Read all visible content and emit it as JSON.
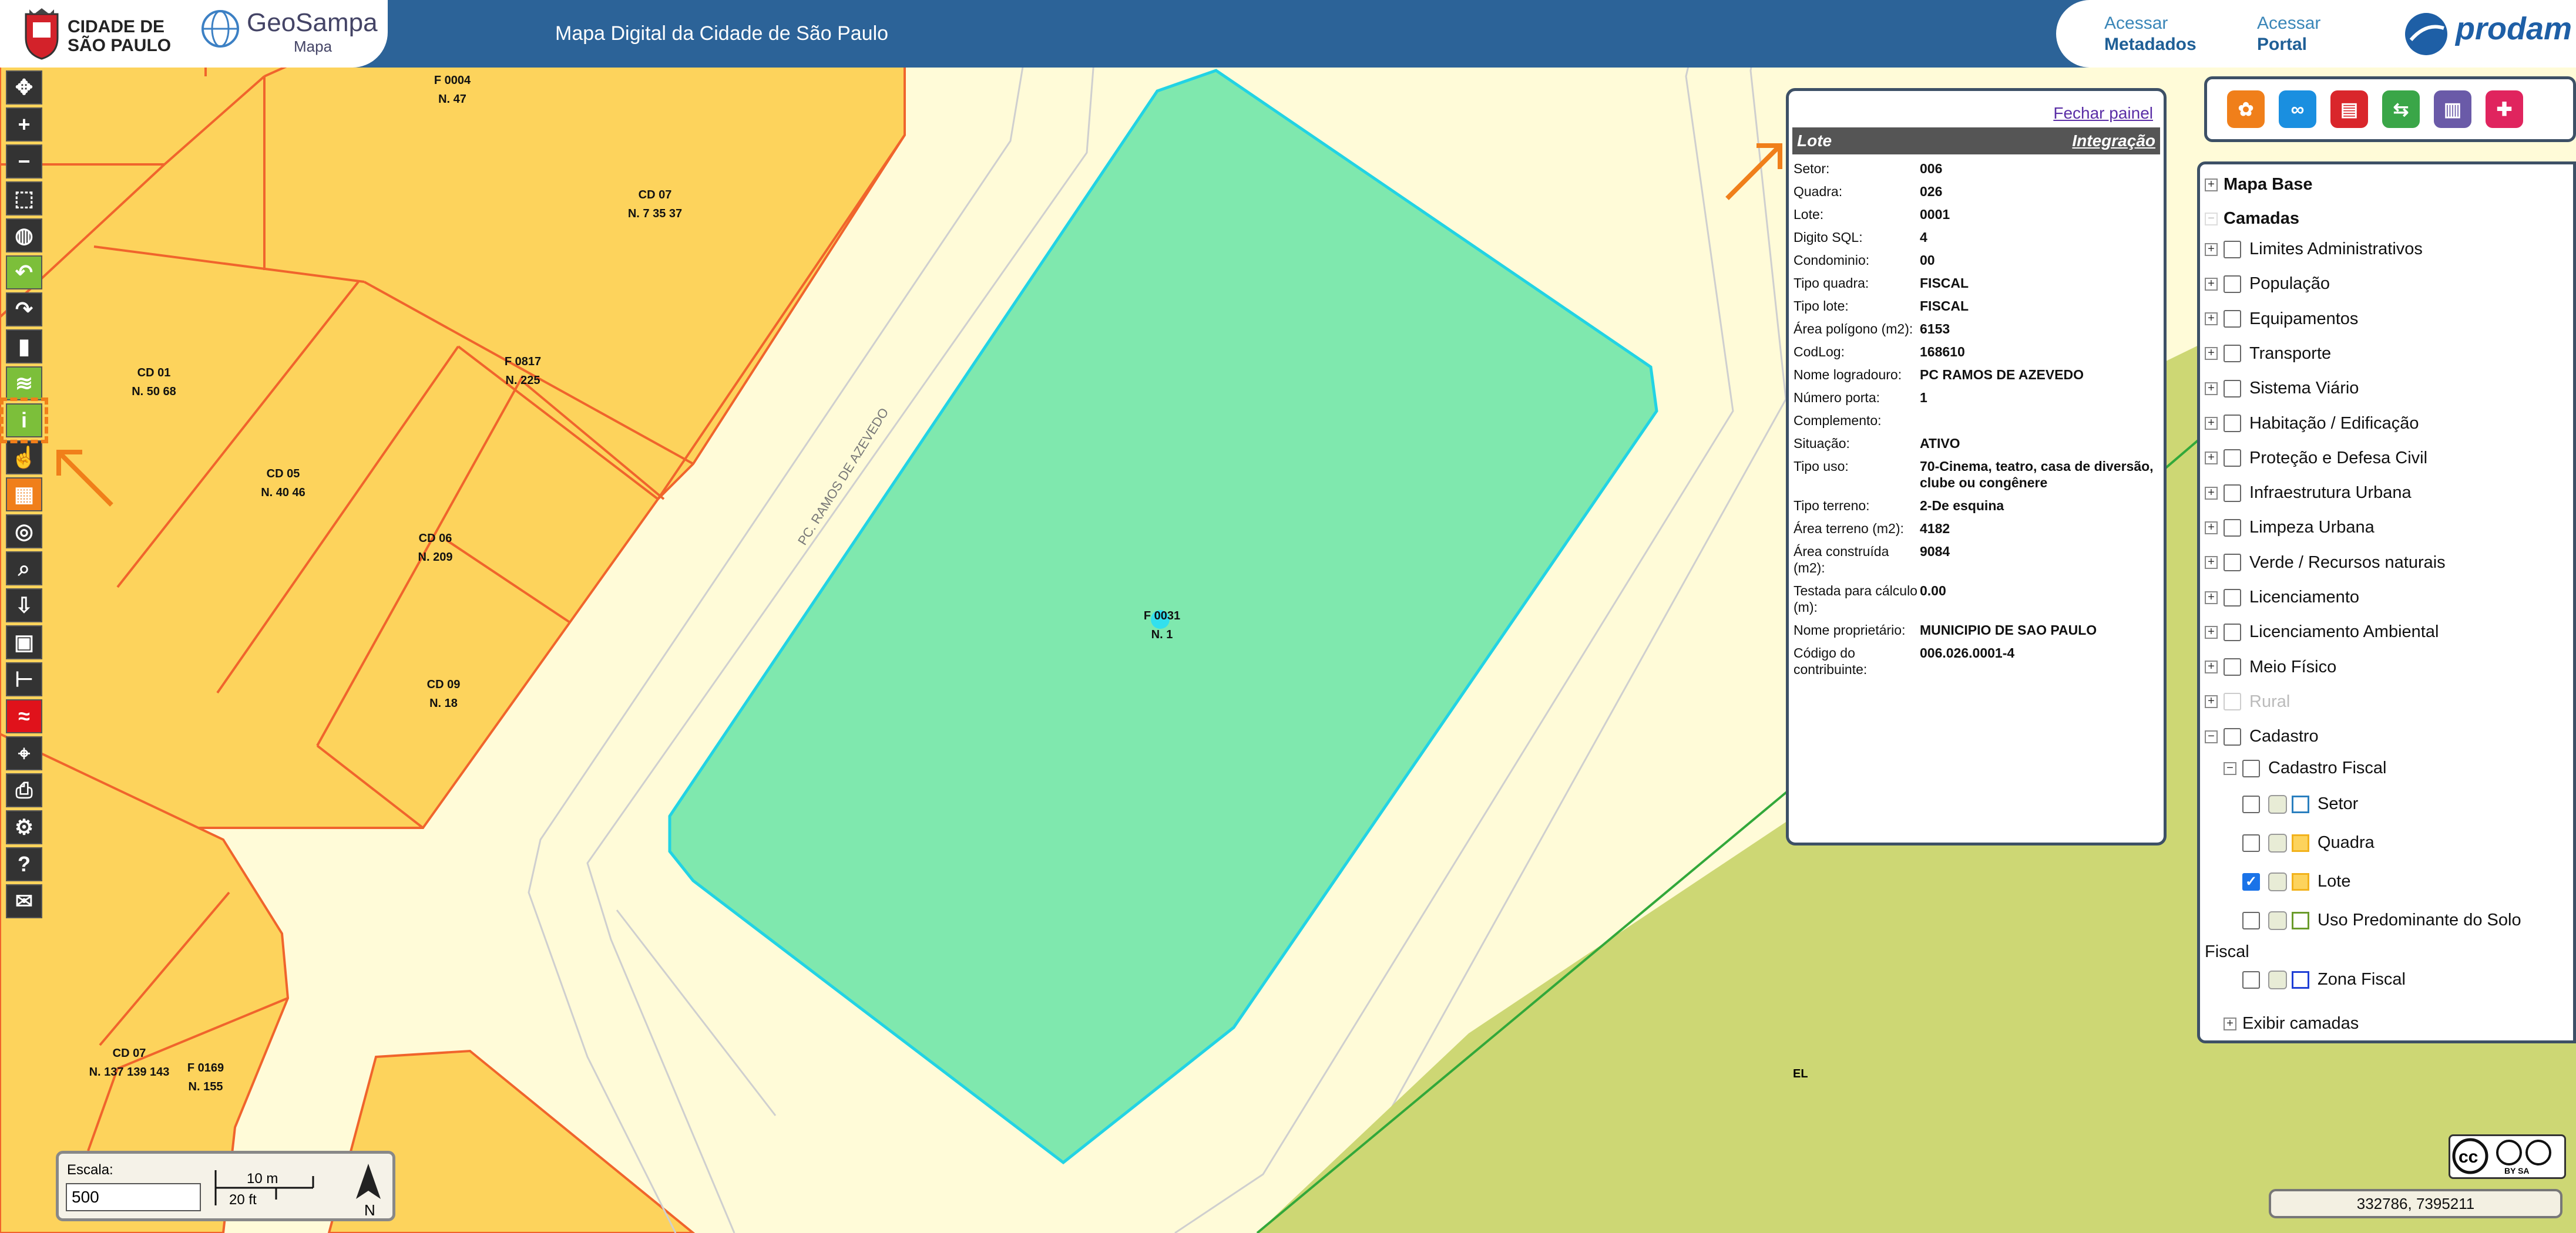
{
  "header": {
    "city_line1": "CIDADE DE",
    "city_line2": "SÃO PAULO",
    "geosampa_name": "GeoSampa",
    "geosampa_sub": "Mapa",
    "title": "Mapa Digital da Cidade de São Paulo",
    "link_metadados_top": "Acessar",
    "link_metadados_bottom": "Metadados",
    "link_portal_top": "Acessar",
    "link_portal_bottom": "Portal",
    "prodam_logo": "prodam"
  },
  "toolbar": {
    "icons": [
      "pan-icon",
      "zoom-in-icon",
      "zoom-out-icon",
      "zoom-box-icon",
      "globe-icon",
      "undo-icon",
      "redo-icon",
      "bookmark-icon",
      "layers-icon",
      "info-icon",
      "hand-pointer-icon",
      "table-icon",
      "search-area-icon",
      "search-icon",
      "download-icon",
      "save-icon",
      "measure-icon",
      "flood-icon",
      "coordinate-icon",
      "print-icon",
      "settings-icon",
      "help-icon",
      "mail-icon"
    ]
  },
  "map": {
    "parcel_labels": [
      {
        "line1": "F 0004",
        "line2": "N. 47"
      },
      {
        "line1": "CD 07",
        "line2": "N. 7 35 37"
      },
      {
        "line1": "CD 01",
        "line2": "N. 50 68"
      },
      {
        "line1": "F 0817",
        "line2": "N. 225"
      },
      {
        "line1": "CD 05",
        "line2": "N. 40 46"
      },
      {
        "line1": "CD 06",
        "line2": "N. 209"
      },
      {
        "line1": "CD 09",
        "line2": "N. 18"
      },
      {
        "line1": "CD 07",
        "line2": "N. 137 139 143"
      },
      {
        "line1": "F 0169",
        "line2": "N. 155"
      },
      {
        "line1": "F 0031",
        "line2": "N. 1"
      }
    ],
    "street_label": "PC. RAMOS DE AZEVEDO",
    "el_label": "EL"
  },
  "info_panel": {
    "close_label": "Fechar painel",
    "title": "Lote",
    "integration_label": "Integração",
    "rows": [
      {
        "key": "Setor:",
        "value": "006"
      },
      {
        "key": "Quadra:",
        "value": "026"
      },
      {
        "key": "Lote:",
        "value": "0001"
      },
      {
        "key": "Digito SQL:",
        "value": "4"
      },
      {
        "key": "Condominio:",
        "value": "00"
      },
      {
        "key": "Tipo quadra:",
        "value": "FISCAL"
      },
      {
        "key": "Tipo lote:",
        "value": "FISCAL"
      },
      {
        "key": "Área polígono (m2):",
        "value": "6153"
      },
      {
        "key": "CodLog:",
        "value": "168610"
      },
      {
        "key": "Nome logradouro:",
        "value": "PC RAMOS DE AZEVEDO"
      },
      {
        "key": "Número porta:",
        "value": "1"
      },
      {
        "key": "Complemento:",
        "value": ""
      },
      {
        "key": "Situação:",
        "value": "ATIVO"
      },
      {
        "key": "Tipo uso:",
        "value": "70-Cinema, teatro, casa de diversão, clube ou congênere"
      },
      {
        "key": "Tipo terreno:",
        "value": "2-De esquina"
      },
      {
        "key": "Área terreno (m2):",
        "value": "4182"
      },
      {
        "key": "Área construída (m2):",
        "value": "9084"
      },
      {
        "key": "Testada para cálculo (m):",
        "value": "0.00"
      },
      {
        "key": "Nome proprietário:",
        "value": "MUNICIPIO DE SAO PAULO"
      },
      {
        "key": "Código do contribuinte:",
        "value": "006.026.0001-4"
      }
    ]
  },
  "right_tools": {
    "colors": [
      "#f07f1a",
      "#1a8fe0",
      "#d9262b",
      "#3aa648",
      "#6a5aa8",
      "#e0245e"
    ]
  },
  "layers": {
    "mapa_base": "Mapa Base",
    "camadas": "Camadas",
    "groups": [
      {
        "label": "Limites Administrativos"
      },
      {
        "label": "População"
      },
      {
        "label": "Equipamentos"
      },
      {
        "label": "Transporte"
      },
      {
        "label": "Sistema Viário"
      },
      {
        "label": "Habitação / Edificação"
      },
      {
        "label": "Proteção e Defesa Civil"
      },
      {
        "label": "Infraestrutura Urbana"
      },
      {
        "label": "Limpeza Urbana"
      },
      {
        "label": "Verde / Recursos naturais"
      },
      {
        "label": "Licenciamento"
      },
      {
        "label": "Licenciamento Ambiental"
      },
      {
        "label": "Meio Físico"
      },
      {
        "label": "Rural"
      },
      {
        "label": "Cadastro"
      }
    ],
    "cadastro_fiscal": "Cadastro Fiscal",
    "sublayers": [
      {
        "label": "Setor",
        "checked": false
      },
      {
        "label": "Quadra",
        "checked": false
      },
      {
        "label": "Lote",
        "checked": true
      },
      {
        "label": "Uso Predominante do Solo",
        "checked": false
      },
      {
        "label": "Zona Fiscal",
        "checked": false
      }
    ],
    "sublayer_wrap": "Fiscal",
    "show_layers": "Exibir camadas"
  },
  "scale": {
    "label": "Escala:",
    "value": "500",
    "bar_top": "10 m",
    "bar_bottom": "20 ft",
    "north": "N"
  },
  "license": {
    "line": "BY SA"
  },
  "coordinates": "332786, 7395211"
}
